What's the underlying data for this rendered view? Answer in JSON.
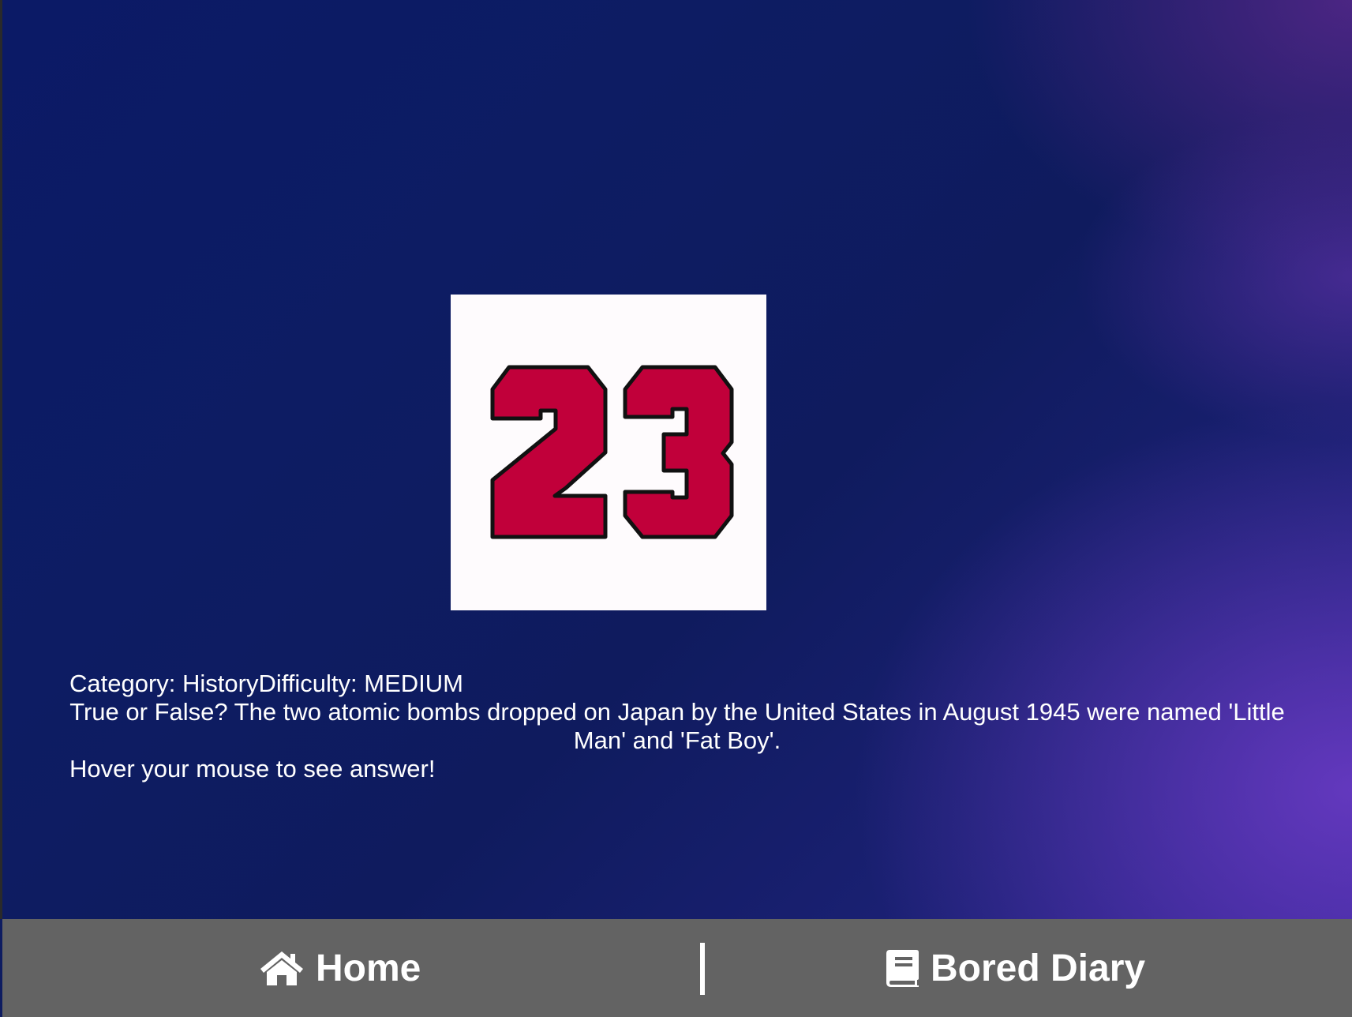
{
  "logo": {
    "icon": "number-23-logo-icon",
    "colors": {
      "fill": "#c1003a",
      "outline": "#111111",
      "background": "#fefbfd"
    }
  },
  "trivia": {
    "meta": "Category: HistoryDifficulty: MEDIUM",
    "question": "True or False? The two atomic bombs dropped on Japan by the United States in August 1945 were named 'Little Man' and 'Fat Boy'.",
    "hint": "Hover your mouse to see answer!"
  },
  "nav": {
    "home": {
      "label": "Home",
      "icon": "home-icon"
    },
    "diary": {
      "label": "Bored Diary",
      "icon": "book-icon"
    }
  },
  "colors": {
    "bar": "#636363",
    "text": "#ffffff",
    "background_main": "#0d1c63",
    "background_accent": "#6e3cc8"
  }
}
